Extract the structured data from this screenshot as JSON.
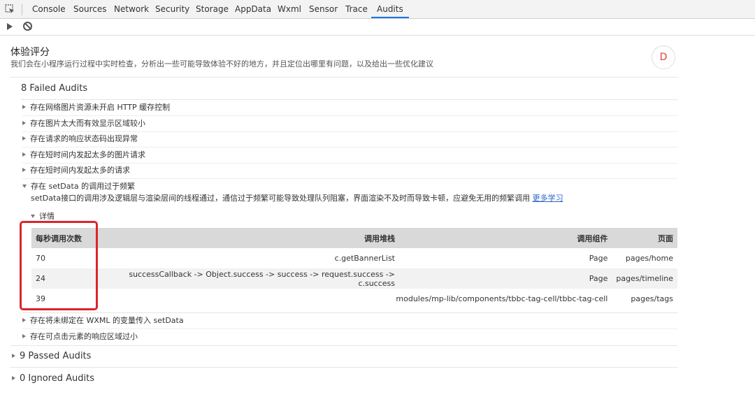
{
  "devtools": {
    "tabs": [
      "Console",
      "Sources",
      "Network",
      "Security",
      "Storage",
      "AppData",
      "Wxml",
      "Sensor",
      "Trace",
      "Audits"
    ],
    "active_tab": "Audits"
  },
  "header": {
    "title": "体验评分",
    "subtitle": "我们会在小程序运行过程中实时检查，分析出一些可能导致体验不好的地方，并且定位出哪里有问题，以及给出一些优化建议",
    "grade": "D"
  },
  "failed": {
    "heading": "8 Failed Audits",
    "items": [
      "存在网络图片资源未开启 HTTP 缓存控制",
      "存在图片太大而有效显示区域较小",
      "存在请求的响应状态码出现异常",
      "存在短时间内发起太多的图片请求",
      "存在短时间内发起太多的请求",
      "存在 setData 的调用过于频繁"
    ],
    "expanded_desc": "setData接口的调用涉及逻辑层与渲染层间的线程通过，通信过于频繁可能导致处理队列阻塞，界面渲染不及时而导致卡顿，应避免无用的频繁调用",
    "learn_more": "更多学习",
    "details_label": "详情",
    "table": {
      "headers": [
        "每秒调用次数",
        "调用堆栈",
        "调用组件",
        "页面"
      ],
      "rows": [
        [
          "70",
          "c.getBannerList",
          "Page",
          "pages/home"
        ],
        [
          "24",
          "successCallback -> Object.success -> success -> request.success -> c.success",
          "Page",
          "pages/timeline"
        ],
        [
          "39",
          "",
          "modules/mp-lib/components/tbbc-tag-cell/tbbc-tag-cell",
          "pages/tags"
        ]
      ]
    },
    "more_items": [
      "存在将未绑定在 WXML 的变量传入 setData",
      "存在可点击元素的响应区域过小"
    ]
  },
  "passed": {
    "heading": "9 Passed Audits"
  },
  "ignored": {
    "heading": "0 Ignored Audits"
  },
  "colors": {
    "grade": "#e0403a",
    "highlight": "#d9262b",
    "active_tab": "#1a73e8",
    "link": "#2a64c8"
  }
}
